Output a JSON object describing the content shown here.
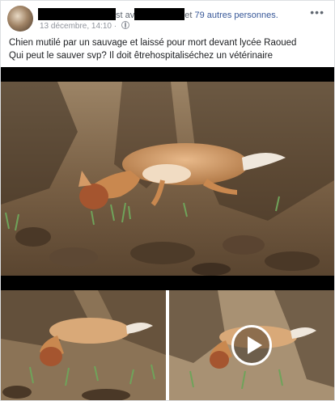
{
  "post": {
    "header": {
      "partial_text_1": "st av",
      "partial_text_2": "et",
      "tagged_others": "79 autres personnes."
    },
    "meta": {
      "date": "13 décembre, 14:10",
      "separator": "·",
      "privacy_icon": "globe-icon"
    },
    "more_icon": "more-options-icon",
    "more_glyph": "•••",
    "text_lines": [
      "Chien mutilé par un sauvage et laissé pour mort devant lycée Raoued",
      "Qui peut le sauver svp? Il doit êtrehospitaliséchez un vétérinaire"
    ],
    "media": {
      "main": "photo of injured dog lying on soil",
      "thumb_1": "photo of injured dog lying on soil",
      "thumb_2": "video thumbnail with play button",
      "play_icon": "play-icon"
    }
  }
}
